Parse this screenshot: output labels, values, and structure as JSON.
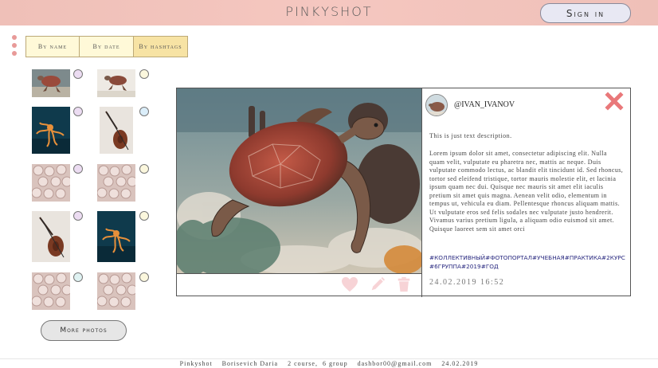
{
  "header": {
    "brand": "PINKYSHOT",
    "signin_label": "Sign in"
  },
  "filters": [
    {
      "label": "By name",
      "active": false
    },
    {
      "label": "By date",
      "active": false
    },
    {
      "label": "By hashtags",
      "active": true
    }
  ],
  "thumbnails": [
    {
      "subject": "turtle",
      "selector_color": "#ecdcf2"
    },
    {
      "subject": "turtle-sand",
      "selector_color": "#fbf7dd"
    },
    {
      "subject": "octopus",
      "selector_color": "#ecdcf2"
    },
    {
      "subject": "violin",
      "selector_color": "#dbeefa"
    },
    {
      "subject": "flowers",
      "selector_color": "#ecdcf2"
    },
    {
      "subject": "flowers",
      "selector_color": "#fbf7dd"
    },
    {
      "subject": "violin",
      "selector_color": "#ecdcf2"
    },
    {
      "subject": "octopus",
      "selector_color": "#fbf7dd"
    },
    {
      "subject": "flowers",
      "selector_color": "#dff2f2"
    },
    {
      "subject": "flowers",
      "selector_color": "#fbf7dd"
    }
  ],
  "more_button": "More photos",
  "post": {
    "username": "@IVAN_IVANOV",
    "short_text": "This is just text description.",
    "long_text": "Lorem ipsum dolor sit amet, consectetur adipiscing elit. Nulla quam velit, vulputate eu pharetra nec, mattis ac neque. Duis vulputate commodo lectus, ac blandit elit tincidunt id. Sed rhoncus, tortor sed eleifend tristique, tortor mauris molestie elit, et lacinia ipsum quam nec dui. Quisque nec mauris sit amet elit iaculis pretium sit amet quis magna. Aenean velit odio, elementum in tempus ut, vehicula eu diam. Pellentesque rhoncus aliquam mattis. Ut vulputate eros sed felis sodales nec vulputate justo hendrerit. Vivamus varius pretium ligula, a aliquam odio euismod sit amet. Quisque laoreet sem sit amet orci",
    "hashtags": "#КОЛЛЕКТИВНЫЙ#ФОТОПОРТАЛ#УЧЕБНАЯ#ПРАКТИКА#2КУРС#6ГРУППА#2019#ГОД",
    "date": "24.02.2019 16:52",
    "icons": [
      "heart-icon",
      "pencil-icon",
      "trash-icon",
      "close-icon"
    ]
  },
  "footer": {
    "text": "Pinkyshot    Borisevich Daria    2 course,  6 group    dashbor00@gmail.com    24.02.2019"
  },
  "colors": {
    "header_pink": "#f5c7c0",
    "tab_yellow": "#fff9d8",
    "tab_active": "#f7e3a4",
    "close_red": "#e9787a",
    "action_pink": "#f7d3d6",
    "hashtag_blue": "#2a2a80"
  }
}
